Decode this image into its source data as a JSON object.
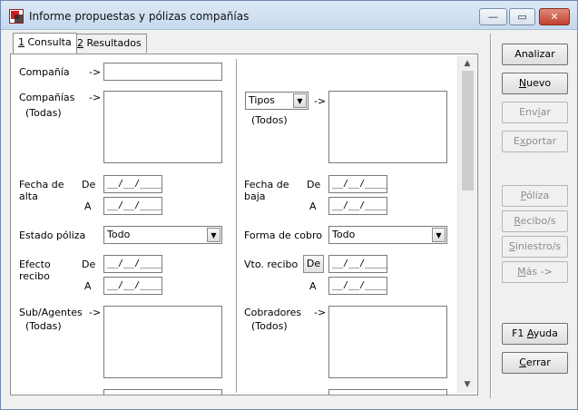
{
  "window": {
    "title": "Informe propuestas y pólizas compañías",
    "minimize": "—",
    "maximize": "▭",
    "close": "✕"
  },
  "tabs": [
    {
      "key": "1",
      "label": " Consulta"
    },
    {
      "key": "2",
      "label": " Resultados"
    }
  ],
  "form": {
    "compania_label": "Compañía",
    "arrow": "->",
    "companias_label": "Compañías",
    "todas": "(Todas)",
    "tipos_value": "Tipos",
    "todos": "(Todos)",
    "fecha_alta_label": "Fecha de\nalta",
    "fecha_baja_label": "Fecha de\nbaja",
    "de": "De",
    "a": "A",
    "date_mask": "__/__/____",
    "estado_poliza_label": "Estado póliza",
    "estado_poliza_value": "Todo",
    "forma_cobro_label": "Forma de cobro",
    "forma_cobro_value": "Todo",
    "efecto_recibo_label": "Efecto\nrecibo",
    "vto_recibo_label": "Vto. recibo",
    "de_button": "De",
    "subagentes_label": "Sub/Agentes",
    "cobradores_label": "Cobradores"
  },
  "buttons": {
    "analizar": "Analizar",
    "nuevo_u": "N",
    "nuevo_rest": "uevo",
    "enviar_pre": "Env",
    "enviar_u": "i",
    "enviar_rest": "ar",
    "exportar_pre": "E",
    "exportar_u": "x",
    "exportar_rest": "portar",
    "poliza_u": "P",
    "poliza_rest": "óliza",
    "recibos_u": "R",
    "recibos_rest": "ecibo/s",
    "siniestros_u": "S",
    "siniestros_rest": "iniestro/s",
    "mas_u": "M",
    "mas_rest": "ás ->",
    "ayuda_pre": "F1 ",
    "ayuda_u": "A",
    "ayuda_rest": "yuda",
    "cerrar_u": "C",
    "cerrar_rest": "errar"
  }
}
